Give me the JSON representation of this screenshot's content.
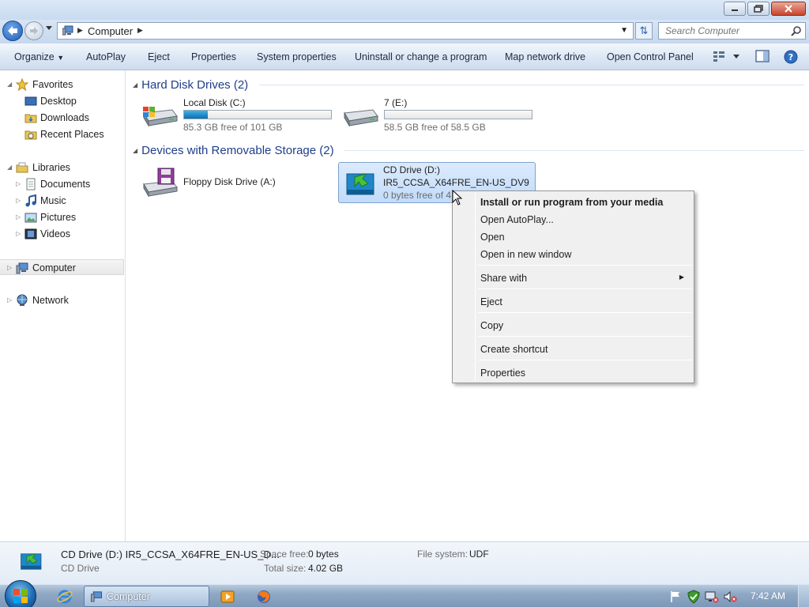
{
  "window": {
    "title": "",
    "minimize_icon": "minimize-icon",
    "maximize_icon": "restore-icon",
    "close_icon": "close-icon"
  },
  "address": {
    "crumbs": [
      "Computer"
    ],
    "search_placeholder": "Search Computer"
  },
  "toolbar": {
    "organize": "Organize",
    "autoplay": "AutoPlay",
    "eject": "Eject",
    "properties": "Properties",
    "system_properties": "System properties",
    "uninstall": "Uninstall or change a program",
    "map_drive": "Map network drive",
    "control_panel": "Open Control Panel"
  },
  "sidebar": {
    "favorites": {
      "label": "Favorites",
      "items": [
        "Desktop",
        "Downloads",
        "Recent Places"
      ]
    },
    "libraries": {
      "label": "Libraries",
      "items": [
        "Documents",
        "Music",
        "Pictures",
        "Videos"
      ]
    },
    "computer": "Computer",
    "network": "Network"
  },
  "groups": {
    "hdd": {
      "title": "Hard Disk Drives (2)",
      "drives": [
        {
          "name": "Local Disk (C:)",
          "free": "85.3 GB free of 101 GB",
          "used_fraction": 0.16
        },
        {
          "name": "7 (E:)",
          "free": "58.5 GB free of 58.5 GB",
          "used_fraction": 0.0
        }
      ]
    },
    "removable": {
      "title": "Devices with Removable Storage (2)",
      "drives": [
        {
          "name": "Floppy Disk Drive (A:)"
        },
        {
          "name": "CD Drive (D:)",
          "label": "IR5_CCSA_X64FRE_EN-US_DV9",
          "free": "0 bytes free of 4."
        }
      ]
    }
  },
  "context_menu": {
    "items": [
      {
        "label": "Install or run program from your media",
        "bold": true
      },
      {
        "label": "Open AutoPlay..."
      },
      {
        "label": "Open"
      },
      {
        "label": "Open in new window"
      },
      {
        "label": "Share with",
        "submenu": true
      },
      {
        "label": "Eject"
      },
      {
        "label": "Copy"
      },
      {
        "label": "Create shortcut"
      },
      {
        "label": "Properties"
      }
    ]
  },
  "details": {
    "name": "CD Drive (D:) IR5_CCSA_X64FRE_EN-US_D...",
    "type": "CD Drive",
    "space_free_label": "Space free:",
    "space_free": "0 bytes",
    "total_size_label": "Total size:",
    "total_size": "4.02 GB",
    "filesystem_label": "File system:",
    "filesystem": "UDF"
  },
  "taskbar": {
    "window_label": "Computer",
    "clock": "7:42 AM"
  },
  "colors": {
    "group_title": "#1e3f8a",
    "bar_fill": "#1f87c8",
    "selection": "#c1dbfa"
  }
}
